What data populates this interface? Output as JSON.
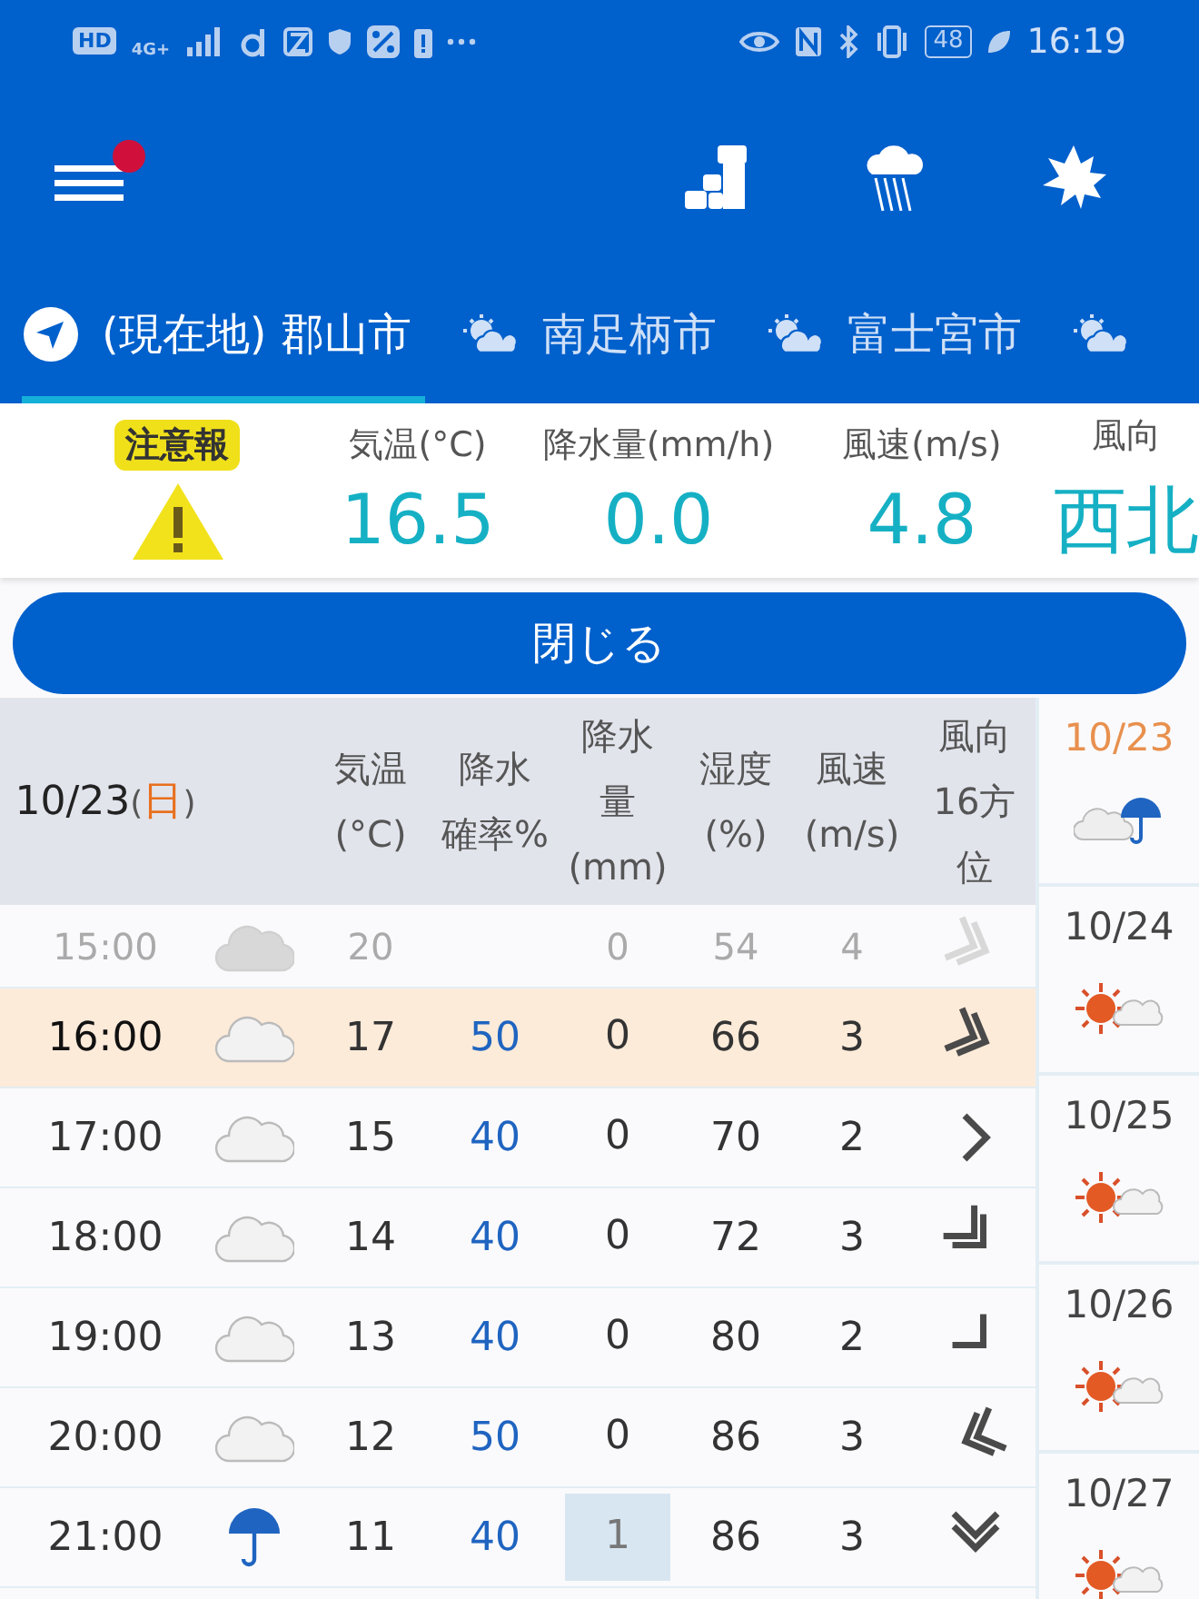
{
  "status_bar": {
    "left": [
      "HD",
      "4G+"
    ],
    "battery": "48",
    "time": "16:19"
  },
  "header": {
    "menu": {
      "badge": true
    }
  },
  "tabs": [
    {
      "label": "(現在地) 郡山市",
      "kind": "location",
      "selected": true
    },
    {
      "label": "南足柄市",
      "kind": "partly_cloudy",
      "selected": false
    },
    {
      "label": "富士宮市",
      "kind": "partly_cloudy",
      "selected": false
    },
    {
      "kind": "partly_cloudy",
      "selected": false
    }
  ],
  "current": {
    "alert": "注意報",
    "items": [
      {
        "label": "気温(°C)",
        "value": "16.5"
      },
      {
        "label": "降水量(mm/h)",
        "value": "0.0"
      },
      {
        "label": "風速(m/s)",
        "value": "4.8"
      },
      {
        "label": "風向",
        "value": "西北"
      }
    ]
  },
  "close_button": "閉じる",
  "table": {
    "date": {
      "open": "10/23",
      "day": "日",
      "paren_open": "(",
      "paren_close": ")"
    },
    "columns": [
      {
        "lines": [
          "気温",
          "(°C)"
        ]
      },
      {
        "lines": [
          "降水",
          "確率%"
        ]
      },
      {
        "lines": [
          "降水",
          "量",
          "(mm)"
        ]
      },
      {
        "lines": [
          "湿度",
          "(%)"
        ]
      },
      {
        "lines": [
          "風速",
          "(m/s)"
        ]
      },
      {
        "lines": [
          "風向",
          "16方",
          "位"
        ]
      }
    ],
    "rows": [
      {
        "time": "15:00",
        "weather": {
          "kind": "cloudy"
        },
        "temp": "20",
        "precip": "0",
        "precip_highlight": false,
        "humidity": "54",
        "wind": "4",
        "dir": {
          "kind": "ese",
          "double": true
        },
        "past": true,
        "selected": false
      },
      {
        "time": "16:00",
        "weather": {
          "kind": "cloudy"
        },
        "temp": "17",
        "prob": "50",
        "precip": "0",
        "precip_highlight": false,
        "humidity": "66",
        "wind": "3",
        "dir": {
          "kind": "ese",
          "double": true
        },
        "past": false,
        "selected": true
      },
      {
        "time": "17:00",
        "weather": {
          "kind": "cloudy"
        },
        "temp": "15",
        "prob": "40",
        "precip": "0",
        "precip_highlight": false,
        "humidity": "70",
        "wind": "2",
        "dir": {
          "kind": "e",
          "double": false
        },
        "past": false,
        "selected": false
      },
      {
        "time": "18:00",
        "weather": {
          "kind": "cloudy"
        },
        "temp": "14",
        "prob": "40",
        "precip": "0",
        "precip_highlight": false,
        "humidity": "72",
        "wind": "3",
        "dir": {
          "kind": "se",
          "double": true
        },
        "past": false,
        "selected": false
      },
      {
        "time": "19:00",
        "weather": {
          "kind": "cloudy"
        },
        "temp": "13",
        "prob": "40",
        "precip": "0",
        "precip_highlight": false,
        "humidity": "80",
        "wind": "2",
        "dir": {
          "kind": "se",
          "double": false
        },
        "past": false,
        "selected": false
      },
      {
        "time": "20:00",
        "weather": {
          "kind": "cloudy"
        },
        "temp": "12",
        "prob": "50",
        "precip": "0",
        "precip_highlight": false,
        "humidity": "86",
        "wind": "3",
        "dir": {
          "kind": "wsw",
          "double": true
        },
        "past": false,
        "selected": false
      },
      {
        "time": "21:00",
        "weather": {
          "kind": "rain"
        },
        "temp": "11",
        "prob": "40",
        "precip": "1",
        "precip_highlight": true,
        "humidity": "86",
        "wind": "3",
        "dir": {
          "kind": "s",
          "double": true
        },
        "past": false,
        "selected": false
      }
    ]
  },
  "days": [
    {
      "date": "10/23",
      "weather": {
        "kind": "cloudy_rain"
      },
      "selected": true
    },
    {
      "date": "10/24",
      "weather": {
        "kind": "sunny_cloudy"
      },
      "selected": false
    },
    {
      "date": "10/25",
      "weather": {
        "kind": "sunny_cloudy"
      },
      "selected": false
    },
    {
      "date": "10/26",
      "weather": {
        "kind": "sunny_cloudy"
      },
      "selected": false
    },
    {
      "date": "10/27",
      "weather": {
        "kind": "sunny_cloudy"
      },
      "selected": false
    }
  ]
}
